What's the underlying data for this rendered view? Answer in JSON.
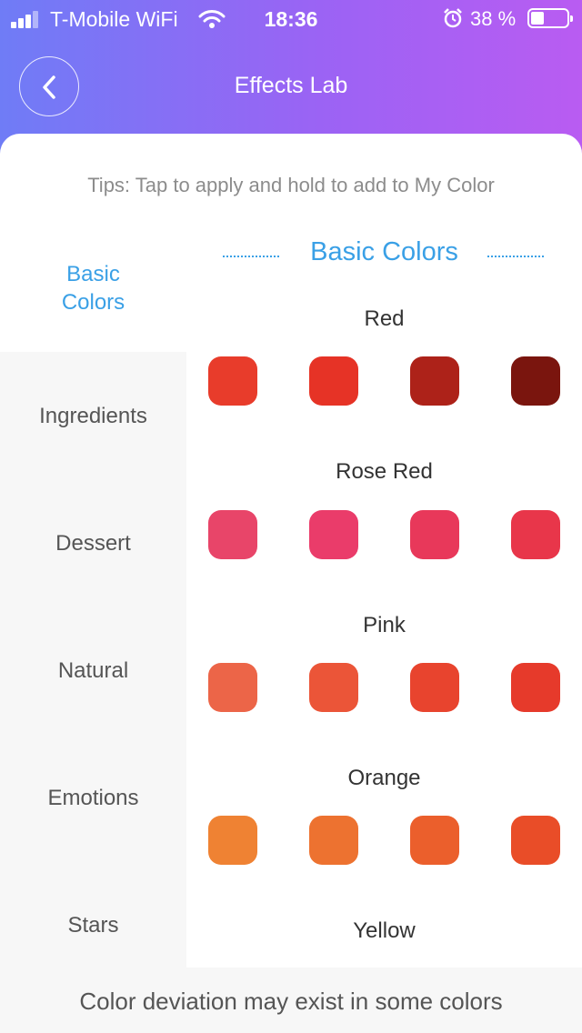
{
  "status_bar": {
    "carrier": "T-Mobile WiFi",
    "time": "18:36",
    "battery": "38 %",
    "battery_level": 0.38,
    "icons": [
      "signal-icon",
      "wifi-icon",
      "alarm-icon",
      "battery-icon"
    ]
  },
  "header": {
    "title": "Effects Lab",
    "back_icon": "chevron-left-icon"
  },
  "tips": "Tips: Tap to apply and hold to add to My Color",
  "sidebar": {
    "items": [
      {
        "label": "Basic\nColors",
        "active": true
      },
      {
        "label": "Ingredients",
        "active": false
      },
      {
        "label": "Dessert",
        "active": false
      },
      {
        "label": "Natural",
        "active": false
      },
      {
        "label": "Emotions",
        "active": false
      },
      {
        "label": "Stars",
        "active": false
      }
    ]
  },
  "section": {
    "title": "Basic Colors"
  },
  "groups": [
    {
      "name": "Red",
      "colors": [
        "#e83c2b",
        "#e63326",
        "#ad2219",
        "#7a150e"
      ]
    },
    {
      "name": "Rose Red",
      "colors": [
        "#e84569",
        "#ea3c6a",
        "#e8385a",
        "#e8364a"
      ]
    },
    {
      "name": "Pink",
      "colors": [
        "#ec6548",
        "#eb5538",
        "#e8442e",
        "#e63a2b"
      ]
    },
    {
      "name": "Orange",
      "colors": [
        "#ef8233",
        "#ed7230",
        "#eb5f2c",
        "#e94d28"
      ]
    },
    {
      "name": "Yellow",
      "colors": []
    }
  ],
  "footer": {
    "text": "Color deviation may exist in some colors"
  },
  "theme": {
    "accent": "#3aa0e6",
    "header_gradient": [
      "#6f7cf6",
      "#b95cf2"
    ]
  }
}
